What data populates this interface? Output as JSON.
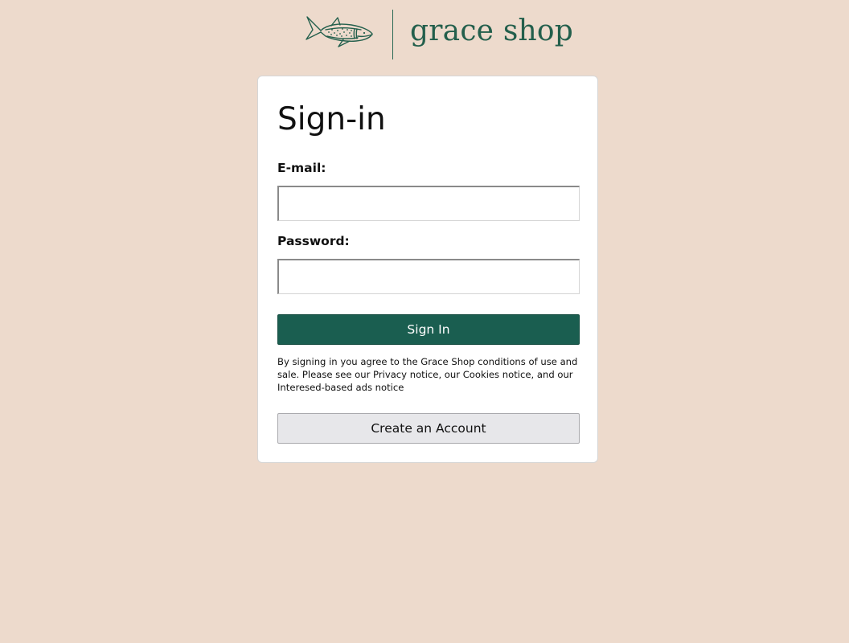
{
  "brand": {
    "name": "grace shop",
    "logo_icon": "whale-shark-icon",
    "color": "#235f4c"
  },
  "signin": {
    "title": "Sign-in",
    "email_label": "E-mail:",
    "email_value": "",
    "password_label": "Password:",
    "password_value": "",
    "submit_label": "Sign In",
    "legal_text": "By signing in you agree to the Grace Shop conditions of use and sale. Please see our Privacy notice, our Cookies notice, and our Interesed-based ads notice",
    "create_account_label": "Create an Account"
  },
  "colors": {
    "page_background": "#eddacc",
    "card_background": "#ffffff",
    "primary_button": "#1a5e50",
    "secondary_button": "#e7e7ea"
  }
}
